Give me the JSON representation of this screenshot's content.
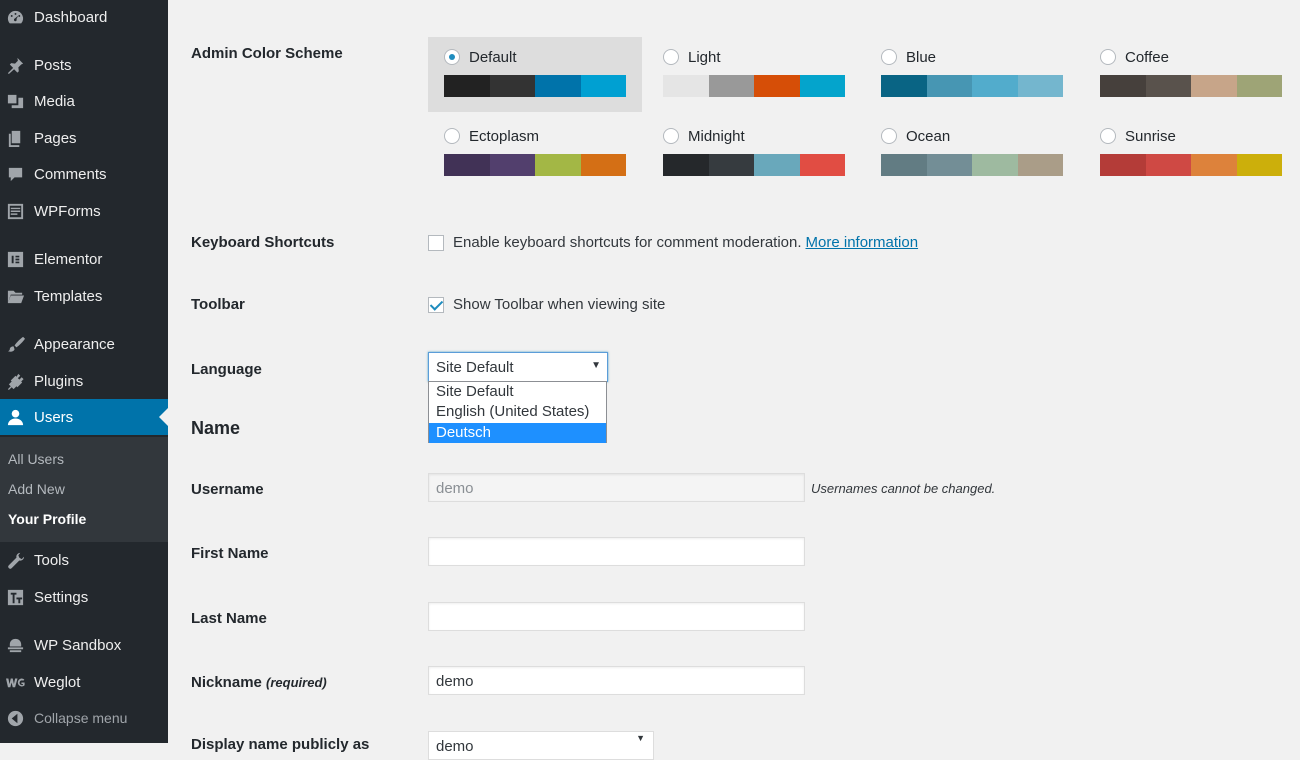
{
  "sidebar": {
    "items": [
      {
        "label": "Dashboard",
        "icon": "dashboard-icon"
      },
      {
        "label": "Posts",
        "icon": "pushpin-icon"
      },
      {
        "label": "Media",
        "icon": "media-icon"
      },
      {
        "label": "Pages",
        "icon": "pages-icon"
      },
      {
        "label": "Comments",
        "icon": "comment-icon"
      },
      {
        "label": "WPForms",
        "icon": "forms-icon"
      },
      {
        "label": "Elementor",
        "icon": "elementor-icon"
      },
      {
        "label": "Templates",
        "icon": "folder-icon"
      },
      {
        "label": "Appearance",
        "icon": "paintbrush-icon"
      },
      {
        "label": "Plugins",
        "icon": "plug-icon"
      },
      {
        "label": "Users",
        "icon": "user-icon"
      },
      {
        "label": "Tools",
        "icon": "wrench-icon"
      },
      {
        "label": "Settings",
        "icon": "settings-icon"
      },
      {
        "label": "WP Sandbox",
        "icon": "sandbox-icon"
      },
      {
        "label": "Weglot",
        "icon": "weglot-icon"
      }
    ],
    "submenu": [
      "All Users",
      "Add New",
      "Your Profile"
    ],
    "collapse_label": "Collapse menu"
  },
  "color_scheme": {
    "label": "Admin Color Scheme",
    "schemes": [
      {
        "name": "Default",
        "colors": [
          "#222222",
          "#333333",
          "#0073aa",
          "#00a0d2"
        ],
        "selected": true
      },
      {
        "name": "Light",
        "colors": [
          "#e5e5e5",
          "#999999",
          "#d64e07",
          "#04a4cc"
        ],
        "selected": false
      },
      {
        "name": "Blue",
        "colors": [
          "#096484",
          "#4796b3",
          "#52accc",
          "#74b6ce"
        ],
        "selected": false
      },
      {
        "name": "Coffee",
        "colors": [
          "#46403c",
          "#59524c",
          "#c7a589",
          "#9ea476"
        ],
        "selected": false
      },
      {
        "name": "Ectoplasm",
        "colors": [
          "#413256",
          "#523f6d",
          "#a3b745",
          "#d46f15"
        ],
        "selected": false
      },
      {
        "name": "Midnight",
        "colors": [
          "#25282b",
          "#363b3f",
          "#69a8bb",
          "#e14d43"
        ],
        "selected": false
      },
      {
        "name": "Ocean",
        "colors": [
          "#627c83",
          "#738e96",
          "#9ebaa0",
          "#aa9d88"
        ],
        "selected": false
      },
      {
        "name": "Sunrise",
        "colors": [
          "#b43c38",
          "#cf4944",
          "#dd823b",
          "#ccaf0b"
        ],
        "selected": false
      }
    ]
  },
  "keyboard_shortcuts": {
    "label": "Keyboard Shortcuts",
    "checkbox_text": "Enable keyboard shortcuts for comment moderation.",
    "link_text": "More information",
    "checked": false
  },
  "toolbar": {
    "label": "Toolbar",
    "checkbox_text": "Show Toolbar when viewing site",
    "checked": true
  },
  "language": {
    "label": "Language",
    "selected": "Site Default",
    "options": [
      "Site Default",
      "English (United States)",
      "Deutsch"
    ],
    "highlighted": "Deutsch"
  },
  "name_section": {
    "heading": "Name",
    "username_label": "Username",
    "username_value": "demo",
    "username_desc": "Usernames cannot be changed.",
    "first_name_label": "First Name",
    "first_name_value": "",
    "last_name_label": "Last Name",
    "last_name_value": "",
    "nickname_label": "Nickname",
    "nickname_required": "(required)",
    "nickname_value": "demo",
    "display_label_partial": "Display name publicly as",
    "display_value_partial": "demo"
  }
}
